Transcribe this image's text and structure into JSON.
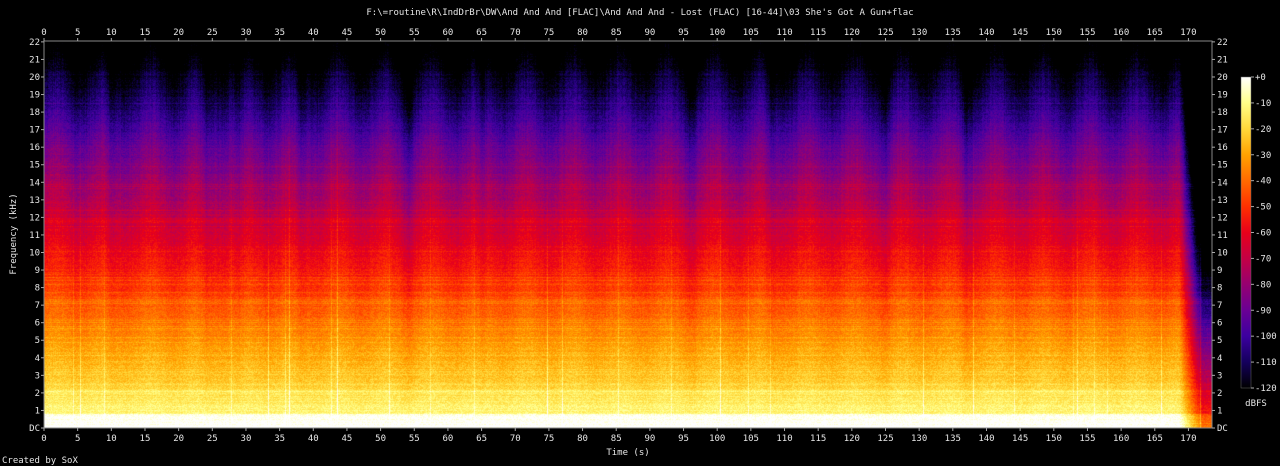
{
  "chart_data": {
    "type": "heatmap",
    "title": "F:\\=routine\\R\\IndDrBr\\DW\\And And And [FLAC]\\And And And - Lost (FLAC) [16-44]\\03 She's Got A Gun+flac",
    "xlabel": "Time (s)",
    "ylabel": "Frequency (kHz)",
    "credit": "Created by SoX",
    "xlim": [
      0,
      173.5
    ],
    "ylim": [
      0,
      22.05
    ],
    "x_ticks": [
      "0",
      "5",
      "10",
      "15",
      "20",
      "25",
      "30",
      "35",
      "40",
      "45",
      "50",
      "55",
      "60",
      "65",
      "70",
      "75",
      "80",
      "85",
      "90",
      "95",
      "100",
      "105",
      "110",
      "115",
      "120",
      "125",
      "130",
      "135",
      "140",
      "145",
      "150",
      "155",
      "160",
      "165",
      "170"
    ],
    "y_ticks": [
      "DC",
      "1",
      "2",
      "3",
      "4",
      "5",
      "6",
      "7",
      "8",
      "9",
      "10",
      "11",
      "12",
      "13",
      "14",
      "15",
      "16",
      "17",
      "18",
      "19",
      "20",
      "21",
      "22"
    ],
    "colorbar": {
      "unit": "dBFS",
      "range": [
        -120,
        0
      ],
      "ticks": [
        "+0",
        "-10",
        "-20",
        "-30",
        "-40",
        "-50",
        "-60",
        "-70",
        "-80",
        "-90",
        "-100",
        "-110",
        "-120"
      ],
      "colors": [
        "#ffffff",
        "#ffff88",
        "#ffd83a",
        "#ffa200",
        "#ff6a00",
        "#ff3000",
        "#e8001a",
        "#c40044",
        "#960070",
        "#6a0094",
        "#3c00a0",
        "#14005c",
        "#000000"
      ]
    },
    "track_end_seconds": 168.5,
    "quiet_breaks_seconds": [
      10,
      24,
      29,
      38,
      54,
      65,
      96,
      108,
      125,
      137
    ]
  }
}
